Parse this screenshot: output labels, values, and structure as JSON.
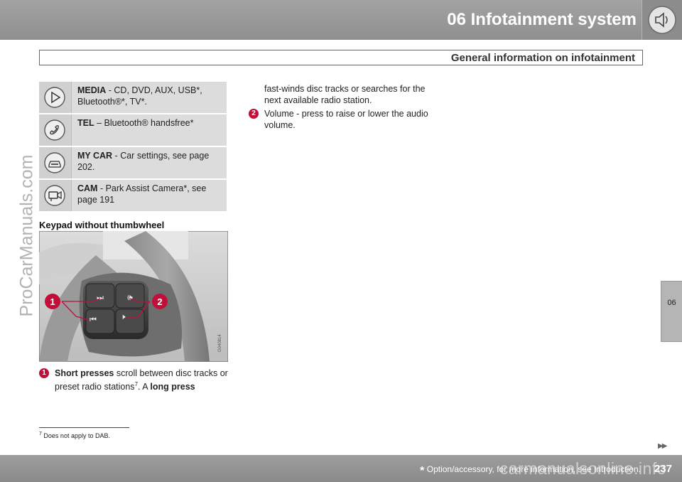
{
  "header": {
    "chapter_title": "06  Infotainment system",
    "section_title": "General information on infotainment",
    "icon": "speaker-icon"
  },
  "watermark_text": "ProCarManuals.com",
  "side_tab": {
    "label": "06"
  },
  "modes": [
    {
      "icon": "play-icon",
      "name": "MEDIA",
      "description": " - CD, DVD, AUX, USB*, Bluetooth®*, TV*."
    },
    {
      "icon": "phone-icon",
      "name": "TEL",
      "description": " – Bluetooth® handsfree*"
    },
    {
      "icon": "car-icon",
      "name": "MY CAR",
      "description": " - Car settings, see page 202."
    },
    {
      "icon": "camera-icon",
      "name": "CAM",
      "description": " - Park Assist Camera*, see page 191"
    }
  ],
  "keypad": {
    "heading": "Keypad without thumbwheel",
    "image_code": "G040814",
    "callout_1": "1",
    "callout_2": "2"
  },
  "legend": [
    {
      "number": "1",
      "bold1": "Short presses",
      "text1": " scroll between disc tracks or preset radio stations",
      "sup": "7",
      "text2": ". A ",
      "bold2": "long press",
      "continuation": "fast-winds disc tracks or searches for the next available radio station."
    },
    {
      "number": "2",
      "text": "Volume - press to raise or lower the audio volume."
    }
  ],
  "footnote": {
    "number": "7",
    "text": "Does not apply to DAB."
  },
  "footer": {
    "star": "*",
    "note": " Option/accessory, for more information, see Introduction.",
    "page_number": "237",
    "watermark": "carmanualsonline.info"
  },
  "colors": {
    "header_gray": "#999999",
    "callout_red": "#c0103a"
  }
}
